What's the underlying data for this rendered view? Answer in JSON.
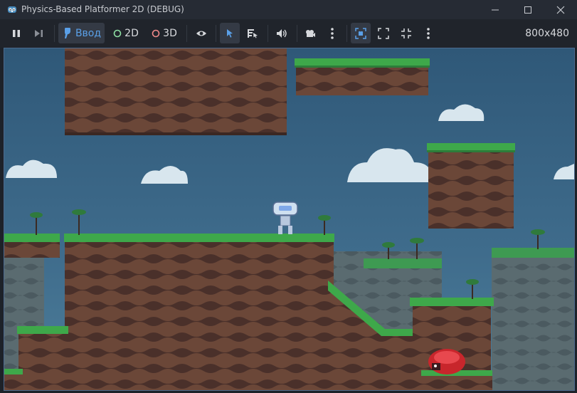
{
  "window": {
    "title": "Physics-Based Platformer 2D (DEBUG)",
    "app_icon": "godot-icon",
    "controls": [
      "minimize-icon",
      "maximize-icon",
      "close-icon"
    ]
  },
  "toolbar": {
    "pause_icon": "pause-icon",
    "step_icon": "step-frame-icon",
    "input_label": "Ввод",
    "mode_2d_label": "2D",
    "mode_3d_label": "3D",
    "visibility_icon": "eye-icon",
    "select_icon": "pointer-icon",
    "list_select_icon": "list-select-icon",
    "audio_icon": "speaker-icon",
    "camera_icon": "camera-icon",
    "more_icon": "vertical-dots-icon",
    "camera_override_icon": "camera-override-icon",
    "resolution": "800x480",
    "colors": {
      "input_active": "#5aa0e8",
      "dot_2d": "#8ee0a4",
      "dot_3d": "#f08a8a"
    }
  },
  "game": {
    "scene": "platformer-level",
    "colors": {
      "sky": "#3f6c8c",
      "grass": "#3ea84a",
      "dirt": "#6e4a3a",
      "cliff": "#5b6e74"
    }
  }
}
